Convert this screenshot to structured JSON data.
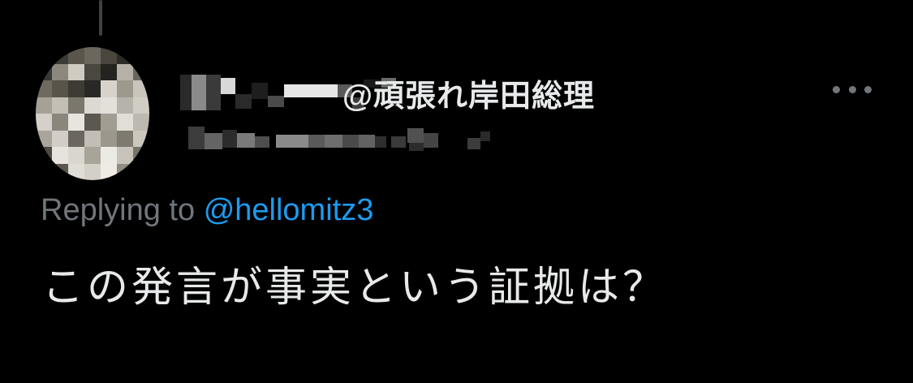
{
  "tweet": {
    "author_handle": "@頑張れ岸田総理",
    "replying_prefix": "Replying to",
    "replying_handle": "@hellomitz3",
    "text": "この発言が事実という証拠は？",
    "more_icon": "more-horizontal-icon"
  },
  "colors": {
    "background": "#000000",
    "text_primary": "#e7e9ea",
    "text_secondary": "#71767b",
    "link": "#1d9bf0"
  }
}
